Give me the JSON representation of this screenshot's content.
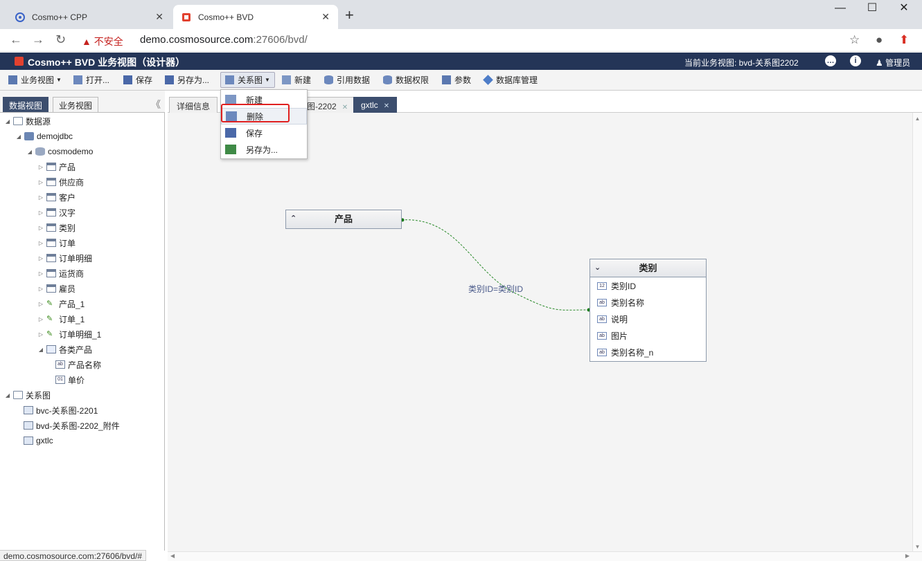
{
  "browser": {
    "tabs": [
      {
        "title": "Cosmo++ CPP"
      },
      {
        "title": "Cosmo++ BVD"
      }
    ],
    "security_label": "不安全",
    "url_host": "demo.cosmosource.com",
    "url_rest": ":27606/bvd/"
  },
  "app": {
    "title": "Cosmo++ BVD 业务视图（设计器）",
    "current_view": "当前业务视图: bvd-关系图2202",
    "user": "管理员"
  },
  "toolbar": {
    "business_view": "业务视图",
    "open": "打开...",
    "save": "保存",
    "save_as": "另存为...",
    "relation": "关系图",
    "new": "新建",
    "ref_data": "引用数据",
    "data_perm": "数据权限",
    "params": "参数",
    "db_manage": "数据库管理"
  },
  "dropdown": {
    "new": "新建",
    "delete": "删除",
    "save": "保存",
    "save_as": "另存为..."
  },
  "left_panel": {
    "tabs": [
      "数据视图",
      "业务视图"
    ],
    "tree": {
      "datasource": "数据源",
      "conn": "demojdbc",
      "schema": "cosmodemo",
      "tables": [
        "产品",
        "供应商",
        "客户",
        "汉字",
        "类别",
        "订单",
        "订单明细",
        "运货商",
        "雇员"
      ],
      "views": [
        "产品_1",
        "订单_1",
        "订单明细_1"
      ],
      "query": "各类产品",
      "query_fields": [
        "产品名称",
        "单价"
      ],
      "relations_root": "关系图",
      "relations": [
        "bvc-关系图-2201",
        "bvd-关系图-2202_附件",
        "gxtlc"
      ]
    }
  },
  "main_tabs": {
    "detail": "详细信息",
    "tab2_partial": "图-2202",
    "tab3": "gxtlc"
  },
  "diagram": {
    "entity1": {
      "title": "产品"
    },
    "entity2": {
      "title": "类别",
      "fields": [
        "类别ID",
        "类别名称",
        "说明",
        "图片",
        "类别名称_n"
      ]
    },
    "relation_label": "类别ID=类别ID"
  },
  "status_url": "demo.cosmosource.com:27606/bvd/#"
}
